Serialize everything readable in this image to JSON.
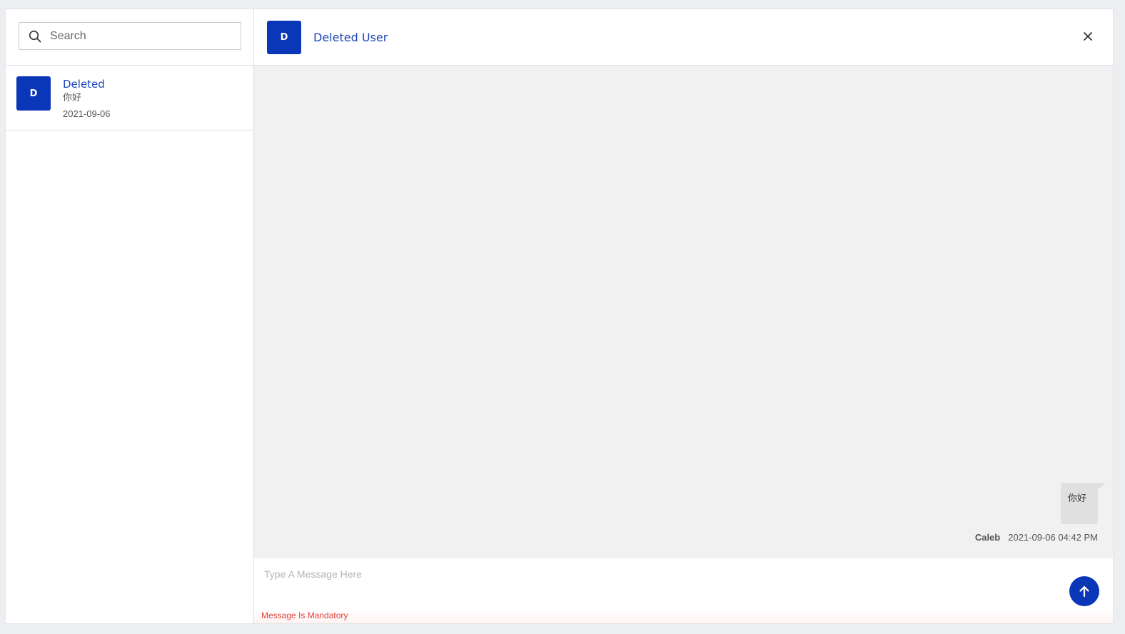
{
  "search": {
    "placeholder": "Search"
  },
  "conversations": [
    {
      "initial": "D",
      "name": "Deleted",
      "preview": "你好",
      "date": "2021-09-06"
    }
  ],
  "chat": {
    "avatar_initial": "D",
    "title": "Deleted User",
    "messages": [
      {
        "text": "你好",
        "sender": "Caleb",
        "timestamp": "2021-09-06 04:42 PM"
      }
    ]
  },
  "composer": {
    "placeholder": "Type A Message Here",
    "error": "Message Is Mandatory"
  },
  "icons": {
    "search": "search-icon",
    "close": "close-icon",
    "send": "arrow-up-icon"
  },
  "colors": {
    "accent": "#0a36b8",
    "link": "#1c45b8",
    "error": "#e0443a",
    "chat_bg": "#f1f1f1",
    "bubble": "#e0e0e0"
  }
}
